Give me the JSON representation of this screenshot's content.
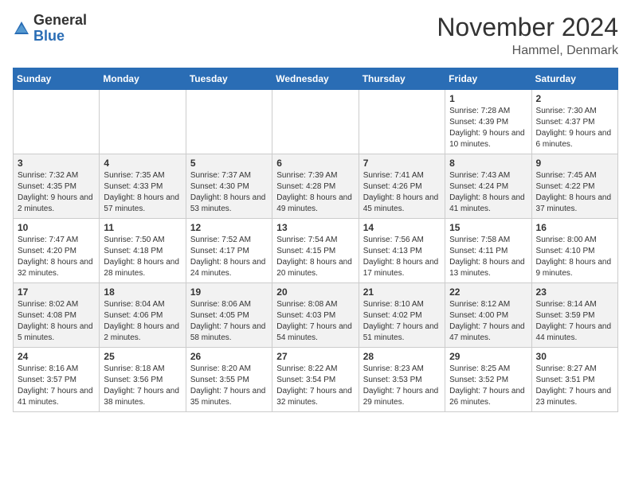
{
  "logo": {
    "general": "General",
    "blue": "Blue"
  },
  "header": {
    "month": "November 2024",
    "location": "Hammel, Denmark"
  },
  "weekdays": [
    "Sunday",
    "Monday",
    "Tuesday",
    "Wednesday",
    "Thursday",
    "Friday",
    "Saturday"
  ],
  "weeks": [
    [
      {
        "day": "",
        "sunrise": "",
        "sunset": "",
        "daylight": ""
      },
      {
        "day": "",
        "sunrise": "",
        "sunset": "",
        "daylight": ""
      },
      {
        "day": "",
        "sunrise": "",
        "sunset": "",
        "daylight": ""
      },
      {
        "day": "",
        "sunrise": "",
        "sunset": "",
        "daylight": ""
      },
      {
        "day": "",
        "sunrise": "",
        "sunset": "",
        "daylight": ""
      },
      {
        "day": "1",
        "sunrise": "Sunrise: 7:28 AM",
        "sunset": "Sunset: 4:39 PM",
        "daylight": "Daylight: 9 hours and 10 minutes."
      },
      {
        "day": "2",
        "sunrise": "Sunrise: 7:30 AM",
        "sunset": "Sunset: 4:37 PM",
        "daylight": "Daylight: 9 hours and 6 minutes."
      }
    ],
    [
      {
        "day": "3",
        "sunrise": "Sunrise: 7:32 AM",
        "sunset": "Sunset: 4:35 PM",
        "daylight": "Daylight: 9 hours and 2 minutes."
      },
      {
        "day": "4",
        "sunrise": "Sunrise: 7:35 AM",
        "sunset": "Sunset: 4:33 PM",
        "daylight": "Daylight: 8 hours and 57 minutes."
      },
      {
        "day": "5",
        "sunrise": "Sunrise: 7:37 AM",
        "sunset": "Sunset: 4:30 PM",
        "daylight": "Daylight: 8 hours and 53 minutes."
      },
      {
        "day": "6",
        "sunrise": "Sunrise: 7:39 AM",
        "sunset": "Sunset: 4:28 PM",
        "daylight": "Daylight: 8 hours and 49 minutes."
      },
      {
        "day": "7",
        "sunrise": "Sunrise: 7:41 AM",
        "sunset": "Sunset: 4:26 PM",
        "daylight": "Daylight: 8 hours and 45 minutes."
      },
      {
        "day": "8",
        "sunrise": "Sunrise: 7:43 AM",
        "sunset": "Sunset: 4:24 PM",
        "daylight": "Daylight: 8 hours and 41 minutes."
      },
      {
        "day": "9",
        "sunrise": "Sunrise: 7:45 AM",
        "sunset": "Sunset: 4:22 PM",
        "daylight": "Daylight: 8 hours and 37 minutes."
      }
    ],
    [
      {
        "day": "10",
        "sunrise": "Sunrise: 7:47 AM",
        "sunset": "Sunset: 4:20 PM",
        "daylight": "Daylight: 8 hours and 32 minutes."
      },
      {
        "day": "11",
        "sunrise": "Sunrise: 7:50 AM",
        "sunset": "Sunset: 4:18 PM",
        "daylight": "Daylight: 8 hours and 28 minutes."
      },
      {
        "day": "12",
        "sunrise": "Sunrise: 7:52 AM",
        "sunset": "Sunset: 4:17 PM",
        "daylight": "Daylight: 8 hours and 24 minutes."
      },
      {
        "day": "13",
        "sunrise": "Sunrise: 7:54 AM",
        "sunset": "Sunset: 4:15 PM",
        "daylight": "Daylight: 8 hours and 20 minutes."
      },
      {
        "day": "14",
        "sunrise": "Sunrise: 7:56 AM",
        "sunset": "Sunset: 4:13 PM",
        "daylight": "Daylight: 8 hours and 17 minutes."
      },
      {
        "day": "15",
        "sunrise": "Sunrise: 7:58 AM",
        "sunset": "Sunset: 4:11 PM",
        "daylight": "Daylight: 8 hours and 13 minutes."
      },
      {
        "day": "16",
        "sunrise": "Sunrise: 8:00 AM",
        "sunset": "Sunset: 4:10 PM",
        "daylight": "Daylight: 8 hours and 9 minutes."
      }
    ],
    [
      {
        "day": "17",
        "sunrise": "Sunrise: 8:02 AM",
        "sunset": "Sunset: 4:08 PM",
        "daylight": "Daylight: 8 hours and 5 minutes."
      },
      {
        "day": "18",
        "sunrise": "Sunrise: 8:04 AM",
        "sunset": "Sunset: 4:06 PM",
        "daylight": "Daylight: 8 hours and 2 minutes."
      },
      {
        "day": "19",
        "sunrise": "Sunrise: 8:06 AM",
        "sunset": "Sunset: 4:05 PM",
        "daylight": "Daylight: 7 hours and 58 minutes."
      },
      {
        "day": "20",
        "sunrise": "Sunrise: 8:08 AM",
        "sunset": "Sunset: 4:03 PM",
        "daylight": "Daylight: 7 hours and 54 minutes."
      },
      {
        "day": "21",
        "sunrise": "Sunrise: 8:10 AM",
        "sunset": "Sunset: 4:02 PM",
        "daylight": "Daylight: 7 hours and 51 minutes."
      },
      {
        "day": "22",
        "sunrise": "Sunrise: 8:12 AM",
        "sunset": "Sunset: 4:00 PM",
        "daylight": "Daylight: 7 hours and 47 minutes."
      },
      {
        "day": "23",
        "sunrise": "Sunrise: 8:14 AM",
        "sunset": "Sunset: 3:59 PM",
        "daylight": "Daylight: 7 hours and 44 minutes."
      }
    ],
    [
      {
        "day": "24",
        "sunrise": "Sunrise: 8:16 AM",
        "sunset": "Sunset: 3:57 PM",
        "daylight": "Daylight: 7 hours and 41 minutes."
      },
      {
        "day": "25",
        "sunrise": "Sunrise: 8:18 AM",
        "sunset": "Sunset: 3:56 PM",
        "daylight": "Daylight: 7 hours and 38 minutes."
      },
      {
        "day": "26",
        "sunrise": "Sunrise: 8:20 AM",
        "sunset": "Sunset: 3:55 PM",
        "daylight": "Daylight: 7 hours and 35 minutes."
      },
      {
        "day": "27",
        "sunrise": "Sunrise: 8:22 AM",
        "sunset": "Sunset: 3:54 PM",
        "daylight": "Daylight: 7 hours and 32 minutes."
      },
      {
        "day": "28",
        "sunrise": "Sunrise: 8:23 AM",
        "sunset": "Sunset: 3:53 PM",
        "daylight": "Daylight: 7 hours and 29 minutes."
      },
      {
        "day": "29",
        "sunrise": "Sunrise: 8:25 AM",
        "sunset": "Sunset: 3:52 PM",
        "daylight": "Daylight: 7 hours and 26 minutes."
      },
      {
        "day": "30",
        "sunrise": "Sunrise: 8:27 AM",
        "sunset": "Sunset: 3:51 PM",
        "daylight": "Daylight: 7 hours and 23 minutes."
      }
    ]
  ]
}
